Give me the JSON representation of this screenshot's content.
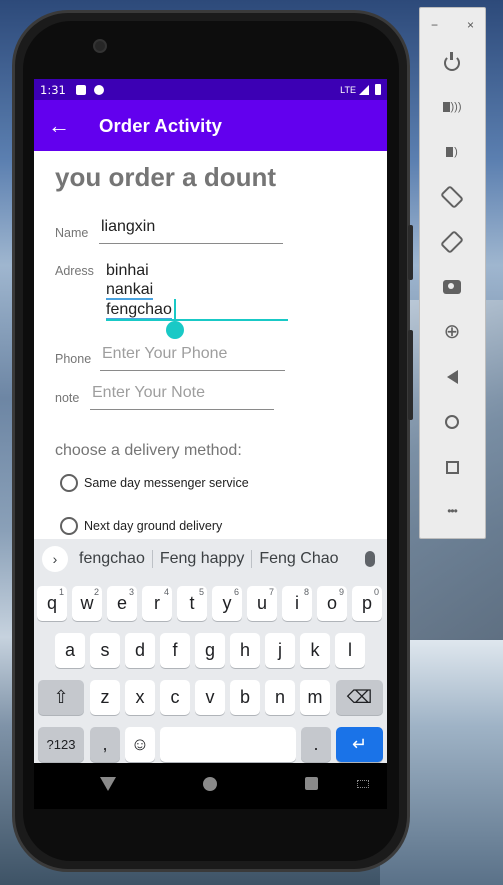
{
  "status_bar": {
    "time": "1:31",
    "network": "LTE"
  },
  "app_bar": {
    "back_glyph": "←",
    "title": "Order Activity"
  },
  "form": {
    "heading": "you order a dount",
    "name_label": "Name",
    "name_value": "liangxin",
    "address_label": "Adress",
    "address_lines": [
      "binhai",
      "nankai",
      "fengchao"
    ],
    "phone_label": "Phone",
    "phone_placeholder": "Enter Your Phone",
    "note_label": "note",
    "note_placeholder": "Enter Your Note",
    "delivery_title": "choose a delivery method:",
    "delivery_options": [
      "Same day messenger service",
      "Next day ground delivery"
    ]
  },
  "keyboard": {
    "expand_glyph": "›",
    "suggestions": [
      "fengchao",
      "Feng happy",
      "Feng Chao"
    ],
    "row1": [
      {
        "k": "q",
        "s": "1"
      },
      {
        "k": "w",
        "s": "2"
      },
      {
        "k": "e",
        "s": "3"
      },
      {
        "k": "r",
        "s": "4"
      },
      {
        "k": "t",
        "s": "5"
      },
      {
        "k": "y",
        "s": "6"
      },
      {
        "k": "u",
        "s": "7"
      },
      {
        "k": "i",
        "s": "8"
      },
      {
        "k": "o",
        "s": "9"
      },
      {
        "k": "p",
        "s": "0"
      }
    ],
    "row2": [
      "a",
      "s",
      "d",
      "f",
      "g",
      "h",
      "j",
      "k",
      "l"
    ],
    "row3": [
      "z",
      "x",
      "c",
      "v",
      "b",
      "n",
      "m"
    ],
    "shift_glyph": "⇧",
    "backspace_glyph": "⌫",
    "symbols_label": "?123",
    "comma_label": ",",
    "emoji_glyph": "☺",
    "period_label": ".",
    "enter_glyph": "↵"
  },
  "emulator_panel": {
    "minimize_glyph": "−",
    "close_glyph": "×",
    "zoom_glyph": "⊕",
    "more_glyph": "•••"
  },
  "colors": {
    "status_bar": "#3c00b4",
    "app_bar": "#6200ee",
    "accent": "#19c9c6",
    "enter_key": "#1a73e8"
  }
}
